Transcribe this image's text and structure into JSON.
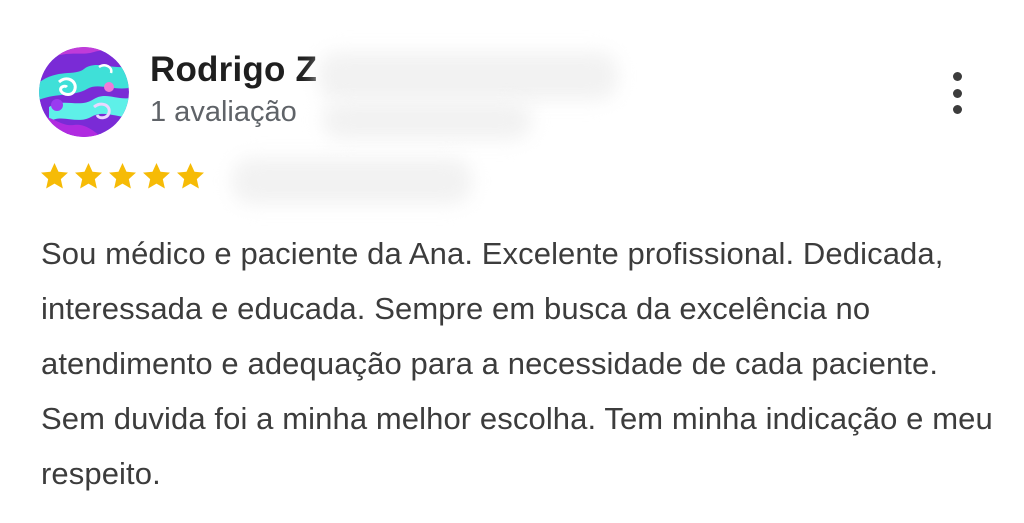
{
  "review": {
    "author_name": "Rodrigo Z",
    "review_count_label": "1 avaliação",
    "rating": 5,
    "rating_max": 5,
    "star_color": "#f6bb06",
    "avatar_icon": "abstract-swirl-avatar",
    "more_icon": "more-vertical-icon",
    "text": "Sou médico e paciente da Ana. Excelente profissional. Dedicada, interessada e educada. Sempre em busca da excelência no atendimento e adequação para a necessidade de cada paciente. Sem duvida foi a minha melhor escolha. Tem minha indicação e meu respeito."
  }
}
